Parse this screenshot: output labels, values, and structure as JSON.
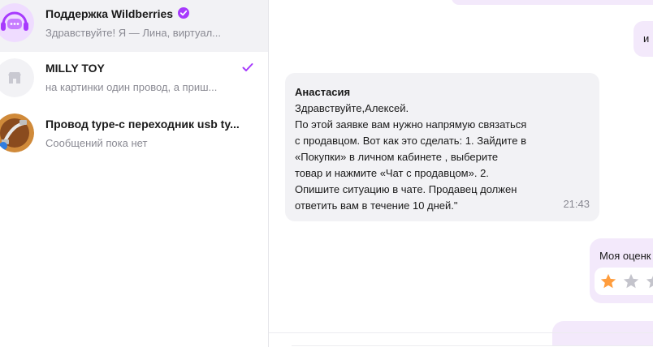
{
  "chats": [
    {
      "title": "Поддержка Wildberries",
      "preview": "Здравствуйте! Я — Лина, виртуал...",
      "verified": true,
      "avatar_icon": "headset-chat-icon",
      "active": true
    },
    {
      "title": "MILLY TOY",
      "preview": "на картинки один провод, а приш...",
      "read": true,
      "avatar_icon": "store-icon"
    },
    {
      "title": "Провод type-c переходник usb ty...",
      "preview": "Сообщений пока нет",
      "avatar_icon": "cable-product-icon"
    }
  ],
  "conversation": {
    "outgoing_partial_1": "и",
    "incoming": {
      "author": "Анастасия",
      "text": "Здравствуйте,Алексей.\nПо этой заявке вам нужно напрямую связаться\nс продавцом. Вот как это сделать: 1. Зайдите в\n«Покупки» в личном кабинете , выберите\nтовар и нажмите «Чат с продавцом». 2.\nОпишите ситуацию в чате. Продавец должен\nответить вам в течение 10 дней.\"",
      "time": "21:43"
    },
    "rating": {
      "title": "Моя оценк",
      "value": 1,
      "max": 5
    }
  },
  "colors": {
    "accent": "#a73afd",
    "outgoing_bubble": "#f3e9fb",
    "incoming_bubble": "#f2f2f5",
    "star_filled": "#ff9d3d",
    "star_empty": "#c4c4cc"
  }
}
